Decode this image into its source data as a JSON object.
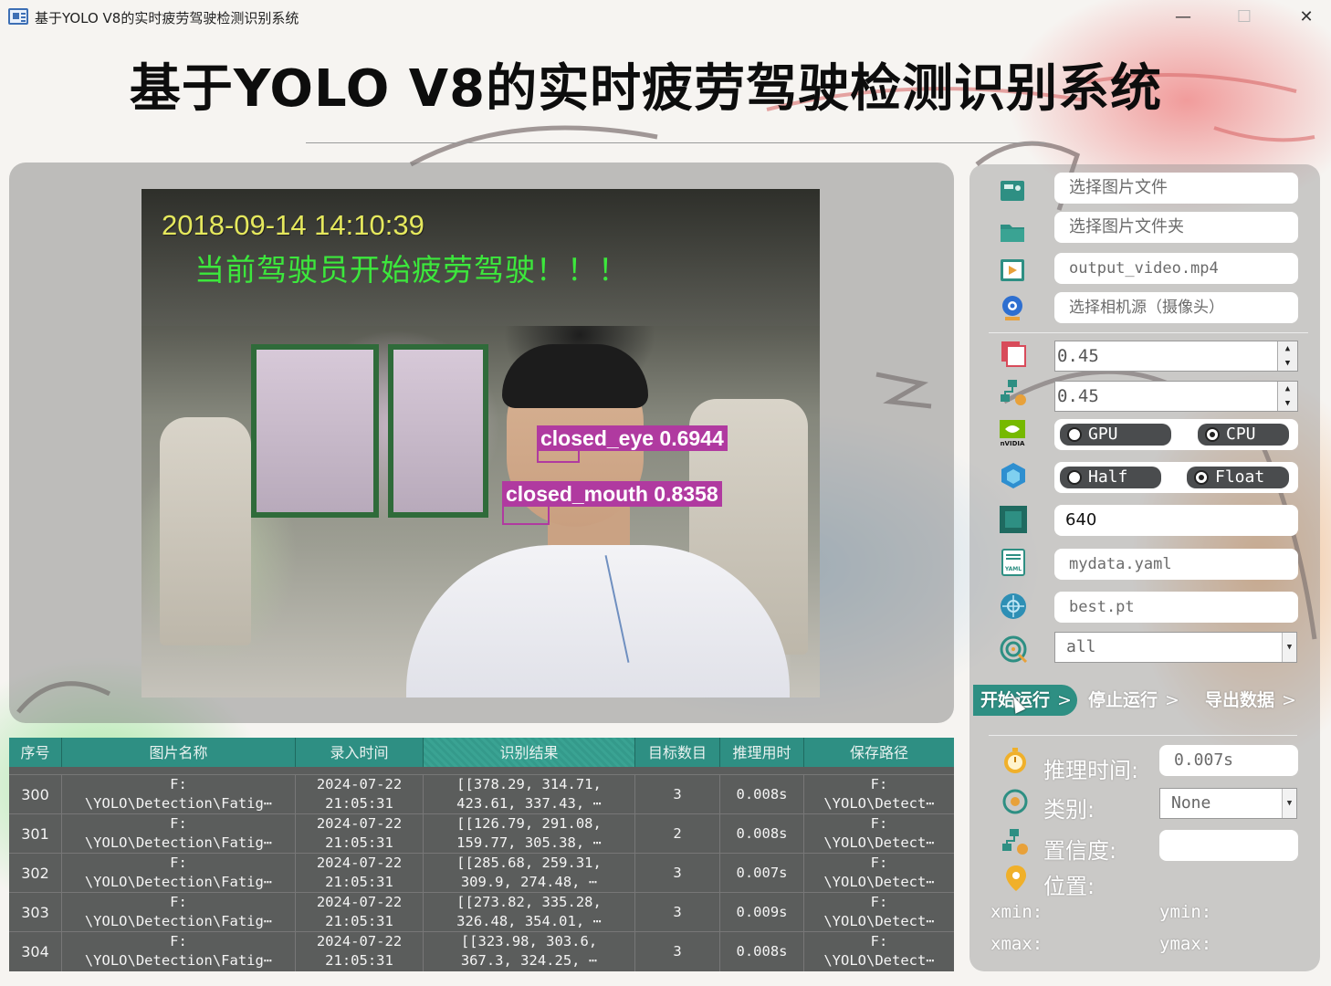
{
  "window": {
    "title": "基于YOLO V8的实时疲劳驾驶检测识别系统",
    "minimize": "—",
    "maximize": "☐",
    "close": "✕"
  },
  "heading": "基于YOLO V8的实时疲劳驾驶检测识别系统",
  "video": {
    "timestamp": "2018-09-14 14:10:39",
    "warning": "当前驾驶员开始疲劳驾驶！！！",
    "detections": [
      {
        "label": "closed_eye 0.6944"
      },
      {
        "label": "closed_mouth 0.8358"
      }
    ]
  },
  "table": {
    "headers": [
      "序号",
      "图片名称",
      "录入时间",
      "识别结果",
      "目标数目",
      "推理用时",
      "保存路径"
    ],
    "rows": [
      {
        "id": "300",
        "name1": "F:",
        "name2": "\\YOLO\\Detection\\Fatig⋯",
        "date": "2024-07-22",
        "time": "21:05:31",
        "res1": "[[378.29, 314.71,",
        "res2": "423.61, 337.43, ⋯",
        "count": "3",
        "dur": "0.008s",
        "path1": "F:",
        "path2": "\\YOLO\\Detect⋯"
      },
      {
        "id": "301",
        "name1": "F:",
        "name2": "\\YOLO\\Detection\\Fatig⋯",
        "date": "2024-07-22",
        "time": "21:05:31",
        "res1": "[[126.79, 291.08,",
        "res2": "159.77, 305.38, ⋯",
        "count": "2",
        "dur": "0.008s",
        "path1": "F:",
        "path2": "\\YOLO\\Detect⋯"
      },
      {
        "id": "302",
        "name1": "F:",
        "name2": "\\YOLO\\Detection\\Fatig⋯",
        "date": "2024-07-22",
        "time": "21:05:31",
        "res1": "[[285.68, 259.31,",
        "res2": "309.9, 274.48, ⋯",
        "count": "3",
        "dur": "0.007s",
        "path1": "F:",
        "path2": "\\YOLO\\Detect⋯"
      },
      {
        "id": "303",
        "name1": "F:",
        "name2": "\\YOLO\\Detection\\Fatig⋯",
        "date": "2024-07-22",
        "time": "21:05:31",
        "res1": "[[273.82, 335.28,",
        "res2": "326.48, 354.01, ⋯",
        "count": "3",
        "dur": "0.009s",
        "path1": "F:",
        "path2": "\\YOLO\\Detect⋯"
      },
      {
        "id": "304",
        "name1": "F:",
        "name2": "\\YOLO\\Detection\\Fatig⋯",
        "date": "2024-07-22",
        "time": "21:05:31",
        "res1": "[[323.98, 303.6,",
        "res2": "367.3, 324.25, ⋯",
        "count": "3",
        "dur": "0.008s",
        "path1": "F:",
        "path2": "\\YOLO\\Detect⋯"
      }
    ]
  },
  "controls": {
    "image_file": "选择图片文件",
    "image_folder": "选择图片文件夹",
    "video_file": "output_video.mp4",
    "camera": "选择相机源（摄像头）",
    "conf_threshold": "0.45",
    "iou_threshold": "0.45",
    "device": {
      "options": [
        "GPU",
        "CPU"
      ],
      "selected": "CPU"
    },
    "precision": {
      "options": [
        "Half",
        "Float"
      ],
      "selected": "Float"
    },
    "img_size": "640",
    "data_yaml": "mydata.yaml",
    "weights": "best.pt",
    "class_filter": "all",
    "icons": [
      "image-file-icon",
      "folder-icon",
      "video-icon",
      "camera-icon",
      "confidence-icon",
      "iou-icon",
      "nvidia-icon",
      "cube-icon",
      "chip-icon",
      "yaml-icon",
      "weights-icon",
      "target-icon"
    ]
  },
  "actions": {
    "start": "开始运行",
    "stop": "停止运行",
    "export": "导出数据",
    "chevron": ">"
  },
  "results": {
    "inference_time_label": "推理时间:",
    "inference_time_value": "0.007s",
    "class_label": "类别:",
    "class_value": "None",
    "confidence_label": "置信度:",
    "confidence_value": "",
    "position_label": "位置:",
    "xmin_label": "xmin:",
    "ymin_label": "ymin:",
    "xmax_label": "xmax:",
    "ymax_label": "ymax:"
  },
  "colors": {
    "accent": "#2e8f83",
    "detection": "#b03aa0",
    "warning_text": "#3ce83c",
    "timestamp_text": "#e5e85d"
  }
}
